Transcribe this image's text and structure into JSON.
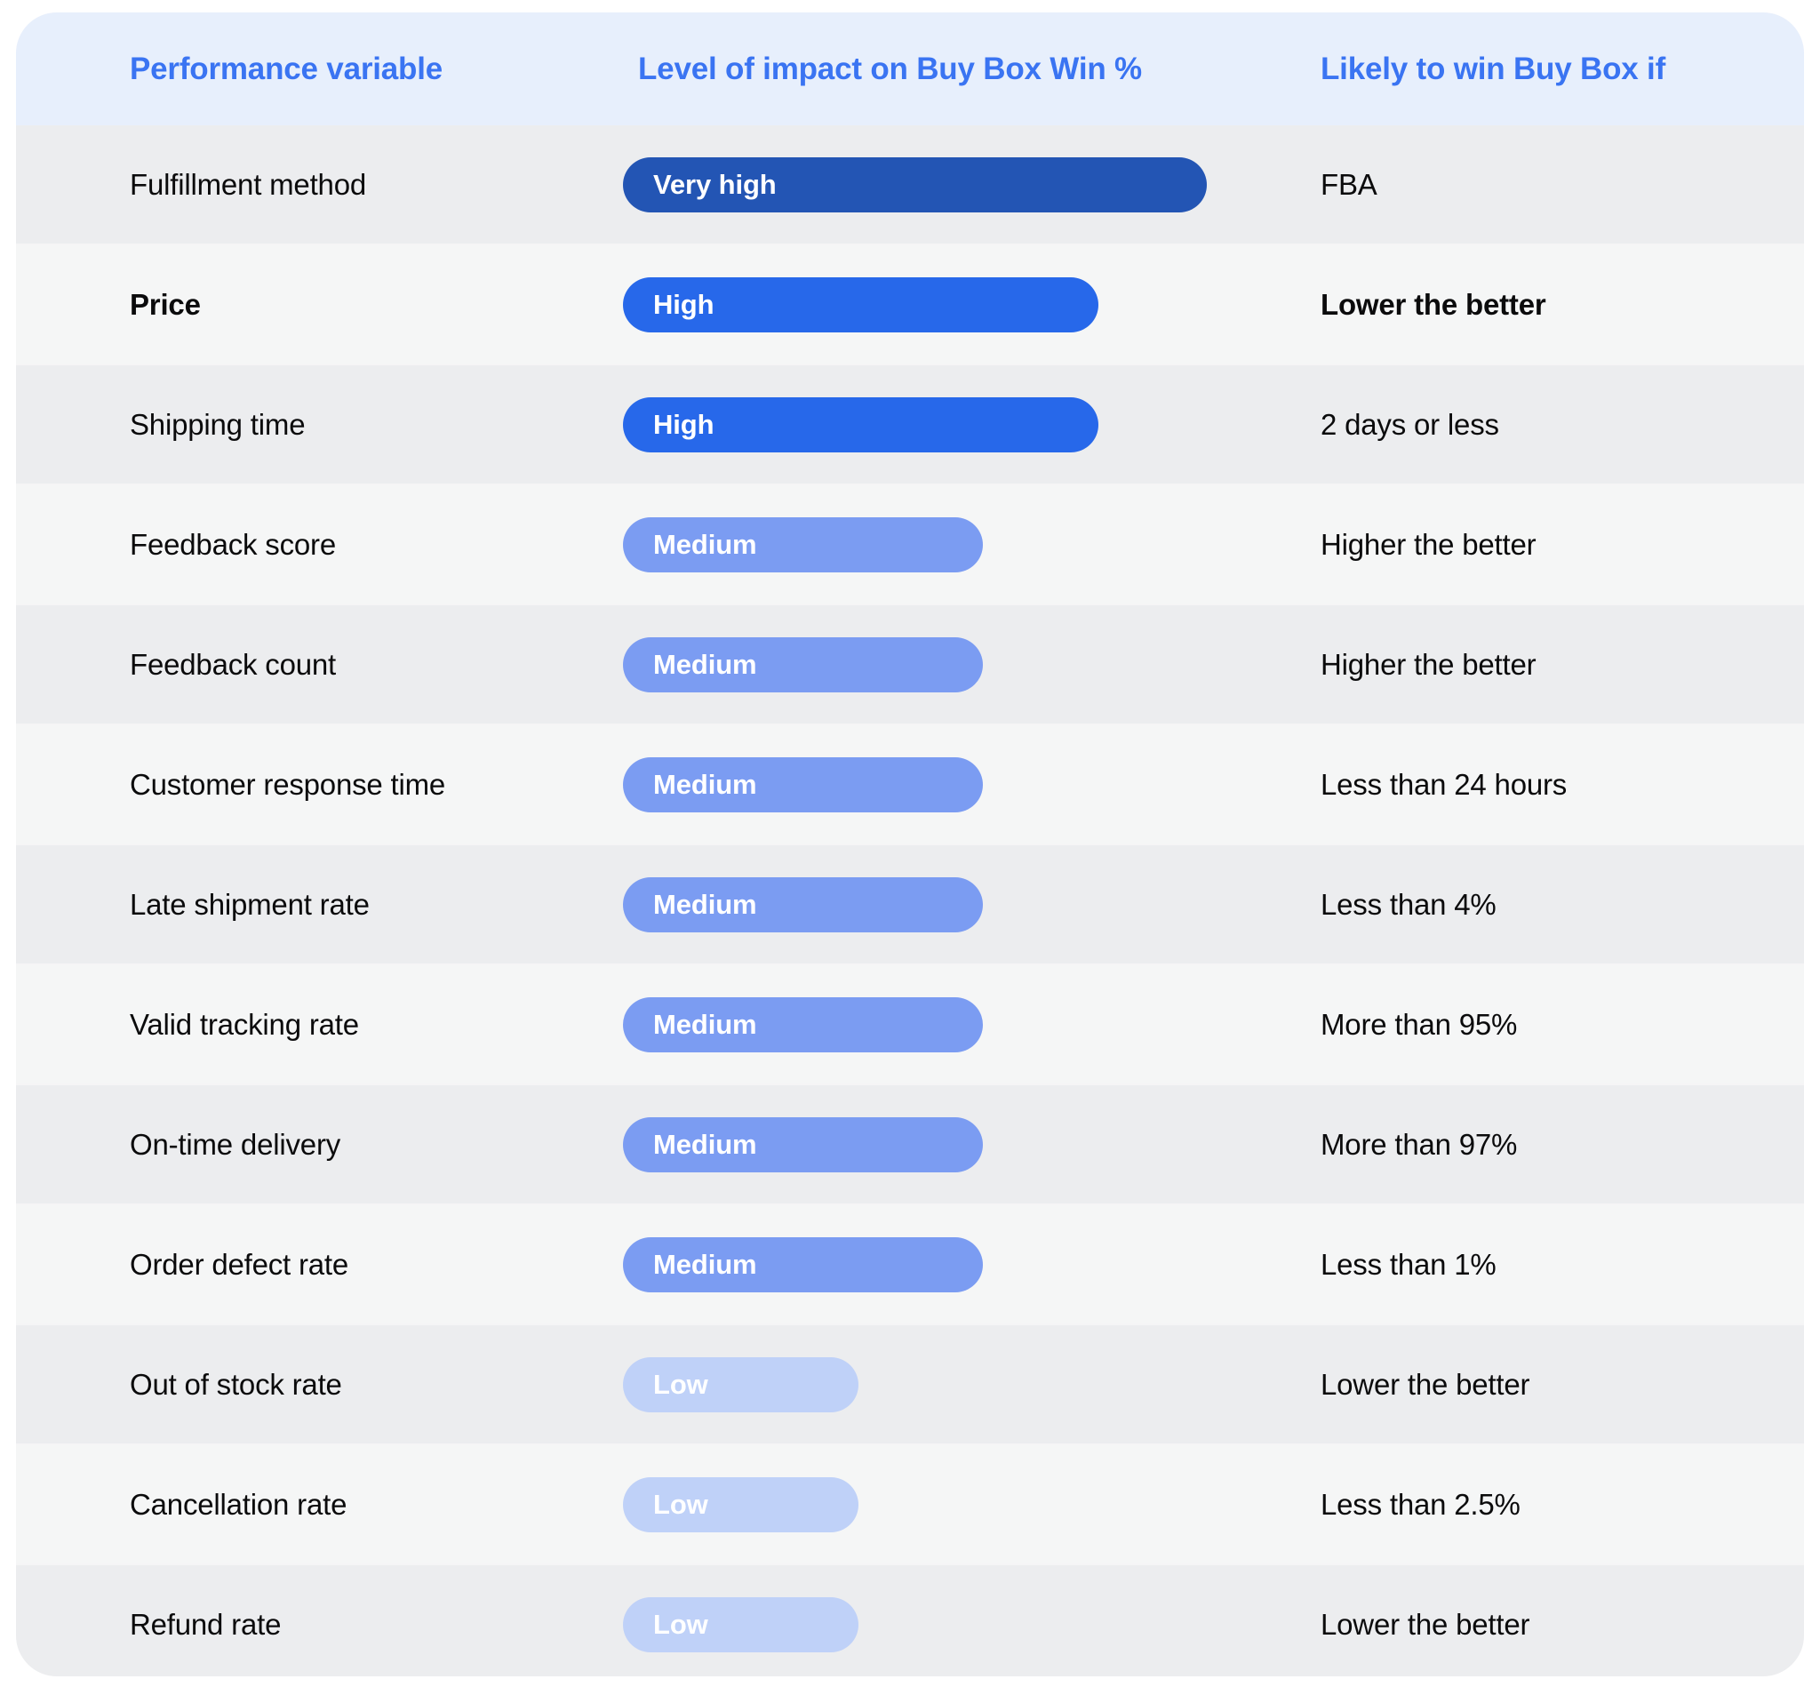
{
  "table": {
    "columns": [
      "Performance variable",
      "Level of impact on Buy Box Win %",
      "Likely to win Buy Box if"
    ],
    "rows": [
      {
        "variable": "Fulfillment method",
        "level": "Very high",
        "level_key": "very-high",
        "condition": "FBA",
        "highlight": false
      },
      {
        "variable": "Price",
        "level": "High",
        "level_key": "high",
        "condition": "Lower the better",
        "highlight": true
      },
      {
        "variable": "Shipping time",
        "level": "High",
        "level_key": "high",
        "condition": "2 days or less",
        "highlight": false
      },
      {
        "variable": "Feedback score",
        "level": "Medium",
        "level_key": "medium",
        "condition": "Higher the better",
        "highlight": false
      },
      {
        "variable": "Feedback count",
        "level": "Medium",
        "level_key": "medium",
        "condition": "Higher the better",
        "highlight": false
      },
      {
        "variable": "Customer response time",
        "level": "Medium",
        "level_key": "medium",
        "condition": "Less than 24 hours",
        "highlight": false
      },
      {
        "variable": "Late shipment rate",
        "level": "Medium",
        "level_key": "medium",
        "condition": "Less than 4%",
        "highlight": false
      },
      {
        "variable": "Valid tracking rate",
        "level": "Medium",
        "level_key": "medium",
        "condition": "More than 95%",
        "highlight": false
      },
      {
        "variable": "On-time delivery",
        "level": "Medium",
        "level_key": "medium",
        "condition": "More than 97%",
        "highlight": false
      },
      {
        "variable": "Order defect rate",
        "level": "Medium",
        "level_key": "medium",
        "condition": "Less than 1%",
        "highlight": false
      },
      {
        "variable": "Out of stock rate",
        "level": "Low",
        "level_key": "low",
        "condition": "Lower the better",
        "highlight": false
      },
      {
        "variable": "Cancellation rate",
        "level": "Low",
        "level_key": "low",
        "condition": "Less than 2.5%",
        "highlight": false
      },
      {
        "variable": "Refund rate",
        "level": "Low",
        "level_key": "low",
        "condition": "Lower the better",
        "highlight": false
      }
    ]
  },
  "colors": {
    "header_background": "#e7effc",
    "header_text": "#3a74f2",
    "row_even": "#ecedef",
    "row_odd": "#f5f6f6",
    "pill_very_high": "#2355b4",
    "pill_high": "#2768ea",
    "pill_medium": "#7b9cf2",
    "pill_low": "#bfd1f8",
    "body_text": "#0b0b0c"
  }
}
